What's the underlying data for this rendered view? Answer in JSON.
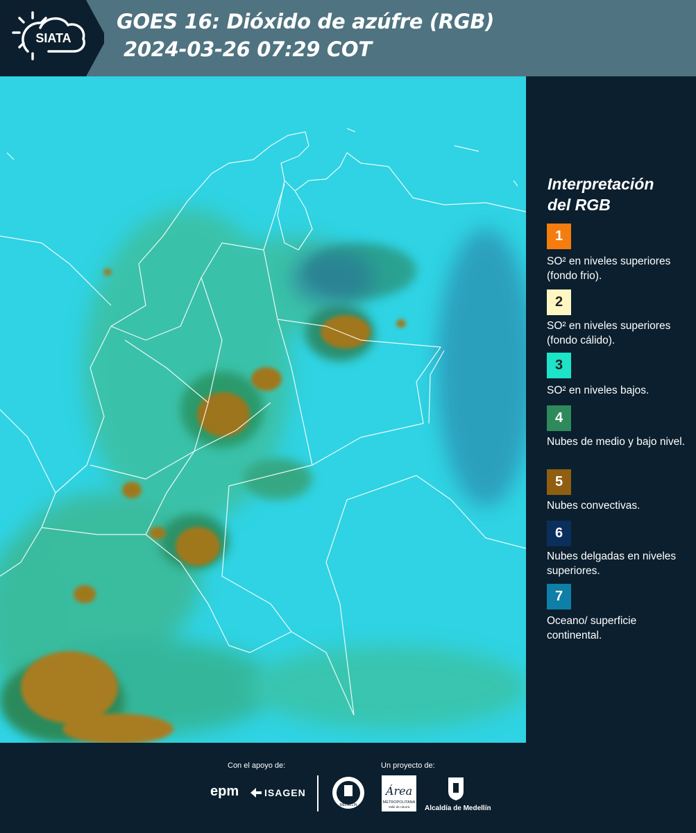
{
  "header": {
    "logo_text": "SIATA",
    "title_line1": "GOES 16: Dióxido de azúfre (RGB)",
    "title_line2": "2024-03-26 07:29 COT"
  },
  "legend": {
    "title_line1": "Interpretación",
    "title_line2": "del RGB",
    "items": [
      {
        "number": "1",
        "color": "#f57c0e",
        "text": "SO² en niveles superiores (fondo frio)."
      },
      {
        "number": "2",
        "color": "#fff7c2",
        "text": "SO² en niveles superiores (fondo cálido)."
      },
      {
        "number": "3",
        "color": "#1de3c8",
        "text": "SO² en niveles bajos."
      },
      {
        "number": "4",
        "color": "#2e8a5a",
        "text": "Nubes de medio y bajo nivel."
      },
      {
        "number": "5",
        "color": "#8f5e10",
        "text": "Nubes convectivas."
      },
      {
        "number": "6",
        "color": "#0b2f5c",
        "text": "Nubes delgadas en niveles superiores."
      },
      {
        "number": "7",
        "color": "#0e7fa6",
        "text": "Oceano/ superficie continental."
      }
    ]
  },
  "footer": {
    "support_label": "Con el apoyo de:",
    "project_label": "Un proyecto de:",
    "brand_epm": "epm",
    "brand_isagen": "ISAGEN",
    "brand_area_main": "Área",
    "brand_area_sub1": "METROPOLITANA",
    "brand_area_sub2": "Valle de Aburrá",
    "brand_alcaldia": "Alcaldía de Medellín",
    "seal_text": "MEDELLÍN"
  },
  "colors": {
    "header_bg": "#4f7380",
    "page_bg": "#0b1f2e",
    "map_base": "#2fd3e3"
  }
}
